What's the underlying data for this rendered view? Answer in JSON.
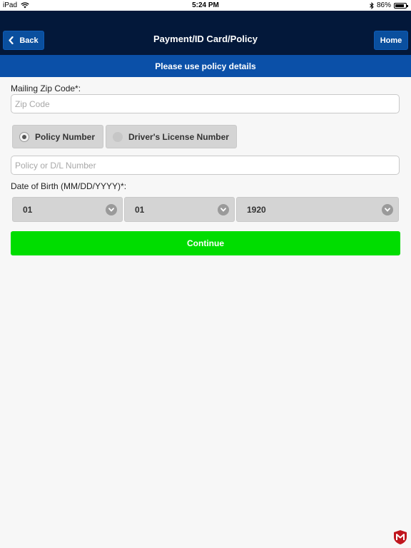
{
  "status_bar": {
    "device": "iPad",
    "time": "5:24 PM",
    "battery": "86%",
    "battery_level": 0.86
  },
  "nav": {
    "back_label": "Back",
    "title": "Payment/ID Card/Policy",
    "home_label": "Home"
  },
  "subheader": {
    "text": "Please use policy details"
  },
  "zip": {
    "label": "Mailing Zip Code*:",
    "placeholder": "Zip Code",
    "value": ""
  },
  "id_type": {
    "options": [
      {
        "label": "Policy Number",
        "selected": true
      },
      {
        "label": "Driver's License Number",
        "selected": false
      }
    ]
  },
  "policy_input": {
    "placeholder": "Policy or D/L Number",
    "value": ""
  },
  "dob": {
    "label": "Date of Birth (MM/DD/YYYY)*:",
    "month": "01",
    "day": "01",
    "year": "1920"
  },
  "continue_label": "Continue",
  "colors": {
    "navbar": "#03183a",
    "subheader": "#0b50a8",
    "button_blue": "#0a4f9e",
    "continue_green": "#00dd00"
  },
  "icons": {
    "wifi": "wifi-icon",
    "bluetooth": "bluetooth-icon",
    "back": "chevron-left-icon",
    "dropdown": "chevron-down-icon",
    "logo": "mcafee-shield-icon"
  }
}
